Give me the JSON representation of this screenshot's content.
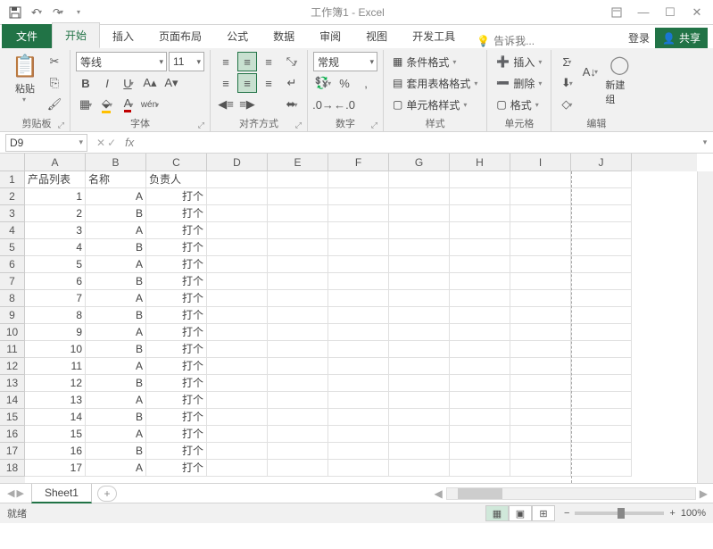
{
  "app": {
    "title": "工作簿1 - Excel"
  },
  "tabs": {
    "file": "文件",
    "items": [
      "开始",
      "插入",
      "页面布局",
      "公式",
      "数据",
      "审阅",
      "视图",
      "开发工具"
    ],
    "active_index": 0,
    "tell_me": "告诉我...",
    "login": "登录",
    "share": "共享"
  },
  "ribbon": {
    "clipboard": {
      "paste": "粘贴",
      "label": "剪贴板"
    },
    "font": {
      "name": "等线",
      "size": "11",
      "label": "字体"
    },
    "alignment": {
      "label": "对齐方式"
    },
    "number": {
      "format": "常规",
      "label": "数字"
    },
    "styles": {
      "cond": "条件格式",
      "table": "套用表格格式",
      "cell": "单元格样式",
      "label": "样式"
    },
    "cells": {
      "insert": "插入",
      "delete": "删除",
      "format": "格式",
      "label": "单元格"
    },
    "editing": {
      "newgroup": "新建组",
      "label": "编辑"
    }
  },
  "namebox": "D9",
  "grid": {
    "cols": [
      "A",
      "B",
      "C",
      "D",
      "E",
      "F",
      "G",
      "H",
      "I",
      "J"
    ],
    "headers": {
      "A": "产品列表",
      "B": "名称",
      "C": "负责人"
    },
    "rows": [
      {
        "n": 1,
        "a": "产品列表",
        "b": "名称",
        "c": "负责人"
      },
      {
        "n": 2,
        "a": "1",
        "b": "A",
        "c": "打个"
      },
      {
        "n": 3,
        "a": "2",
        "b": "B",
        "c": "打个"
      },
      {
        "n": 4,
        "a": "3",
        "b": "A",
        "c": "打个"
      },
      {
        "n": 5,
        "a": "4",
        "b": "B",
        "c": "打个"
      },
      {
        "n": 6,
        "a": "5",
        "b": "A",
        "c": "打个"
      },
      {
        "n": 7,
        "a": "6",
        "b": "B",
        "c": "打个"
      },
      {
        "n": 8,
        "a": "7",
        "b": "A",
        "c": "打个"
      },
      {
        "n": 9,
        "a": "8",
        "b": "B",
        "c": "打个"
      },
      {
        "n": 10,
        "a": "9",
        "b": "A",
        "c": "打个"
      },
      {
        "n": 11,
        "a": "10",
        "b": "B",
        "c": "打个"
      },
      {
        "n": 12,
        "a": "11",
        "b": "A",
        "c": "打个"
      },
      {
        "n": 13,
        "a": "12",
        "b": "B",
        "c": "打个"
      },
      {
        "n": 14,
        "a": "13",
        "b": "A",
        "c": "打个"
      },
      {
        "n": 15,
        "a": "14",
        "b": "B",
        "c": "打个"
      },
      {
        "n": 16,
        "a": "15",
        "b": "A",
        "c": "打个"
      },
      {
        "n": 17,
        "a": "16",
        "b": "B",
        "c": "打个"
      },
      {
        "n": 18,
        "a": "17",
        "b": "A",
        "c": "打个"
      }
    ]
  },
  "sheet": {
    "name": "Sheet1"
  },
  "status": {
    "ready": "就绪",
    "zoom": "100%"
  }
}
